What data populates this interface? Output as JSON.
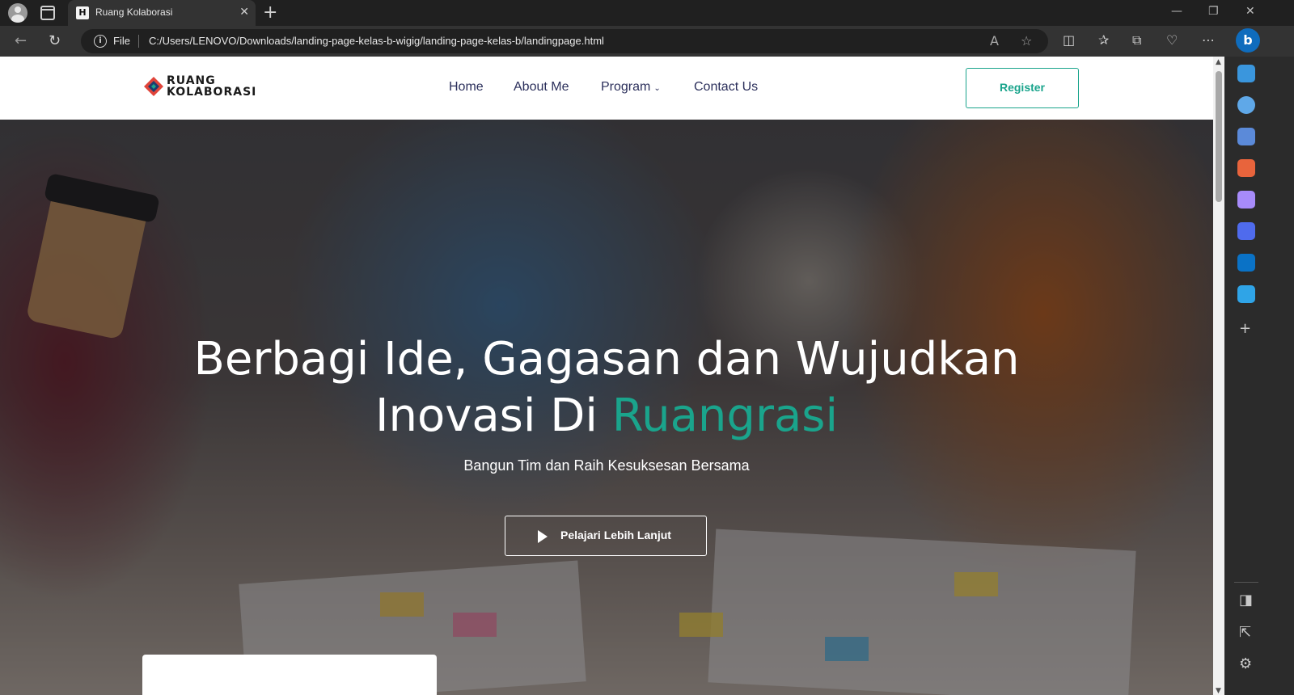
{
  "browser": {
    "tab_title": "Ruang Kolaborasi",
    "tab_favicon": "H",
    "file_label": "File",
    "url": "C:/Users/LENOVO/Downloads/landing-page-kelas-b-wigig/landing-page-kelas-b/landingpage.html",
    "icons": [
      "profile-icon",
      "tab-actions-icon",
      "close-icon",
      "new-tab-icon",
      "minimize-icon",
      "restore-icon",
      "window-close-icon",
      "back-icon",
      "refresh-icon",
      "info-icon",
      "read-aloud-icon",
      "favorite-icon",
      "split-screen-icon",
      "favorites-icon",
      "collections-icon",
      "browser-essentials-icon",
      "more-icon",
      "bing-icon"
    ]
  },
  "edge_sidebar": {
    "icons": [
      "bell-icon",
      "search-icon",
      "shopping-icon",
      "tools-icon",
      "games-icon",
      "copilot-icon",
      "outlook-icon",
      "drop-icon",
      "add-icon",
      "sidebar-toggle-icon",
      "external-icon",
      "settings-icon"
    ],
    "colors": [
      "#3a96dd",
      "#5fa8e8",
      "#5b8ad9",
      "#e8643c",
      "#a78bfa",
      "#4f6bed",
      "#0a72c6",
      "#2fa4e7"
    ]
  },
  "site": {
    "logo_line1": "RUANG",
    "logo_line2": "KOLABORASI",
    "nav": {
      "home": "Home",
      "about": "About Me",
      "program": "Program",
      "contact": "Contact Us"
    },
    "register": "Register"
  },
  "hero": {
    "title_line1": "Berbagi Ide, Gagasan dan Wujudkan",
    "title_line2_prefix": "Inovasi Di",
    "title_line2_accent": "Ruangrasi",
    "subtitle": "Bangun Tim dan Raih Kesuksesan Bersama",
    "cta_label": "Pelajari Lebih Lanjut"
  },
  "colors": {
    "accent": "#1aa48c",
    "nav_text": "#2b2f5b",
    "browser_bg": "#202020"
  }
}
